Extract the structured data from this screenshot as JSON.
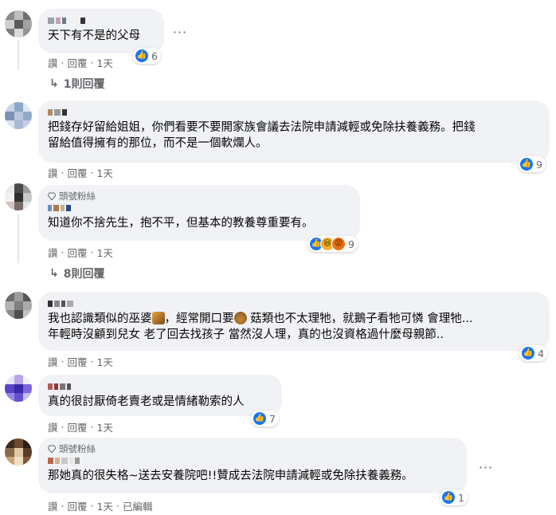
{
  "comments": [
    {
      "text": "天下有不是的父母",
      "actions": {
        "like": "讚",
        "reply": "回覆",
        "time": "1天"
      },
      "reaction_count": "6",
      "replies_label": "1則回覆"
    },
    {
      "text_lines": [
        "把錢存好留給姐姐，你們看要不要開家族會議去法院申請減輕或免除扶養義務。把錢",
        "留給值得擁有的那位，而不是一個軟爛人。"
      ],
      "actions": {
        "like": "讚",
        "reply": "回覆",
        "time": "1天"
      },
      "reaction_count": "9"
    },
    {
      "badge": "頭號粉絲",
      "text": "知道你不捨先生，抱不平，但基本的教養尊重要有。",
      "actions": {
        "like": "讚",
        "reply": "回覆",
        "time": "1天"
      },
      "reaction_count": "9",
      "replies_label": "8則回覆"
    },
    {
      "text_line1_a": "我也認識類似的巫婆",
      "text_line1_b": "，經常開口要",
      "text_line1_c": " 菇類也不太理牠，就鵝子看牠可憐 會理牠...",
      "text_line2": "年輕時沒顧到兒女 老了回去找孩子 當然沒人理，真的也沒資格過什麼母親節..",
      "actions": {
        "like": "讚",
        "reply": "回覆",
        "time": "1天"
      },
      "reaction_count": "4"
    },
    {
      "text": "真的很討厭倚老賣老或是情緒勒索的人",
      "actions": {
        "like": "讚",
        "reply": "回覆",
        "time": "1天"
      },
      "reaction_count": "7"
    },
    {
      "badge": "頭號粉絲",
      "text": "那她真的很失格~送去安養院吧!!贊成去法院申請減輕或免除扶養義務。",
      "actions": {
        "like": "讚",
        "reply": "回覆",
        "time": "1天",
        "edited": "已編輯"
      },
      "reaction_count": "1"
    }
  ],
  "more_icon": "···",
  "reply_arrow_icon": "↳",
  "colors": {
    "bubble": "#f0f2f5",
    "like_blue": "#1877f2",
    "meta_gray": "#65676b"
  }
}
